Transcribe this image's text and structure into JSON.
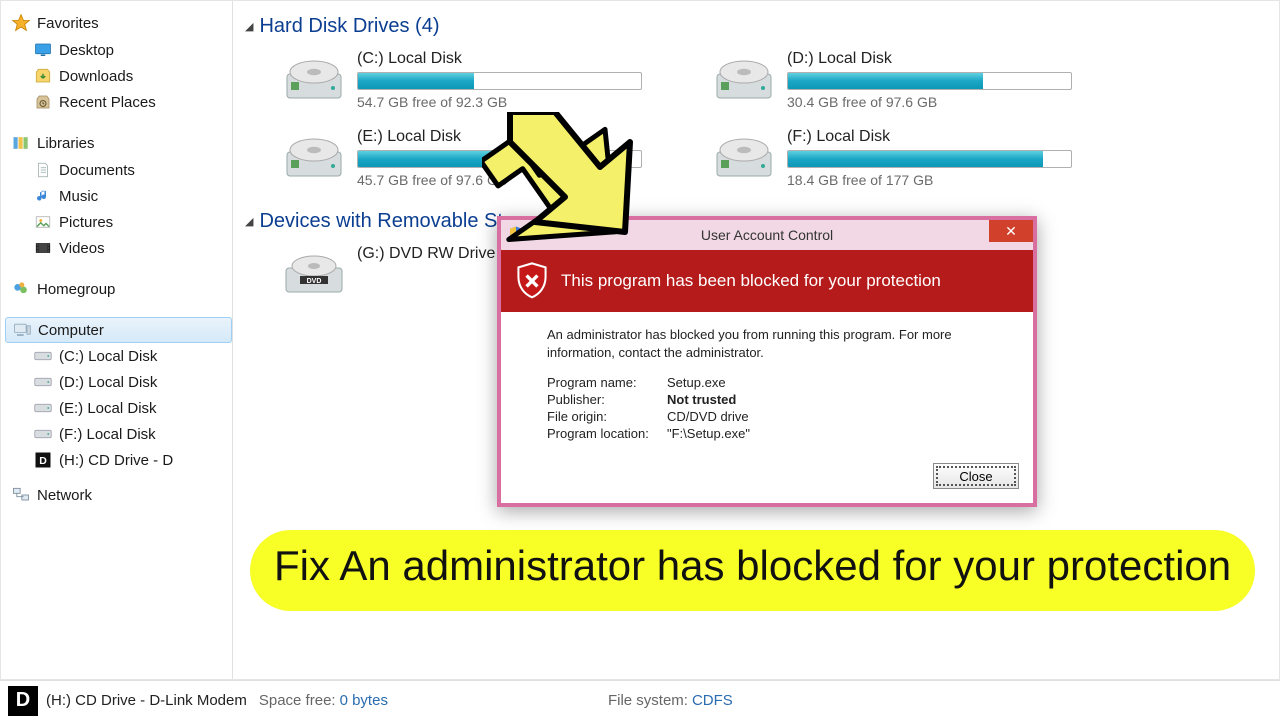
{
  "sidebar": {
    "favorites": {
      "label": "Favorites",
      "items": [
        {
          "label": "Desktop",
          "icon": "desktop-icon"
        },
        {
          "label": "Downloads",
          "icon": "downloads-icon"
        },
        {
          "label": "Recent Places",
          "icon": "recent-places-icon"
        }
      ]
    },
    "libraries": {
      "label": "Libraries",
      "items": [
        {
          "label": "Documents",
          "icon": "documents-icon"
        },
        {
          "label": "Music",
          "icon": "music-icon"
        },
        {
          "label": "Pictures",
          "icon": "pictures-icon"
        },
        {
          "label": "Videos",
          "icon": "videos-icon"
        }
      ]
    },
    "homegroup": {
      "label": "Homegroup"
    },
    "computer": {
      "label": "Computer",
      "items": [
        {
          "label": "(C:) Local Disk",
          "icon": "hdd-icon"
        },
        {
          "label": "(D:) Local Disk",
          "icon": "hdd-icon"
        },
        {
          "label": "(E:) Local Disk",
          "icon": "hdd-icon"
        },
        {
          "label": "(F:) Local Disk",
          "icon": "hdd-icon"
        },
        {
          "label": "(H:) CD Drive - D",
          "icon": "cd-icon"
        }
      ]
    },
    "network": {
      "label": "Network"
    }
  },
  "content": {
    "hdd_section": "Hard Disk Drives (4)",
    "removable_section": "Devices with Removable Storage",
    "drives": [
      {
        "name": "(C:) Local Disk",
        "free": "54.7 GB free of 92.3 GB",
        "fill_pct": 41
      },
      {
        "name": "(D:) Local Disk",
        "free": "30.4 GB free of 97.6 GB",
        "fill_pct": 69
      },
      {
        "name": "(E:) Local Disk",
        "free": "45.7 GB free of 97.6 GB",
        "fill_pct": 53
      },
      {
        "name": "(F:) Local Disk",
        "free": "18.4 GB free of 177 GB",
        "fill_pct": 90
      }
    ],
    "removable": [
      {
        "name": "(G:) DVD RW Drive"
      }
    ]
  },
  "uac": {
    "title": "User Account Control",
    "headline": "This program has been blocked for your protection",
    "message": "An administrator has blocked you from running this program. For more information, contact the administrator.",
    "rows": [
      {
        "k": "Program name:",
        "v": "Setup.exe"
      },
      {
        "k": "Publisher:",
        "v": "Not trusted",
        "bold": true
      },
      {
        "k": "File origin:",
        "v": "CD/DVD drive"
      },
      {
        "k": "Program location:",
        "v": "\"F:\\Setup.exe\""
      }
    ],
    "close_label": "Close"
  },
  "statusbar": {
    "title": "(H:) CD Drive - D-Link Modem",
    "space_label": "Space free:",
    "space_value": "0 bytes",
    "fs_label": "File system:",
    "fs_value": "CDFS"
  },
  "annotation": {
    "caption": "Fix An administrator has blocked for your protection"
  }
}
